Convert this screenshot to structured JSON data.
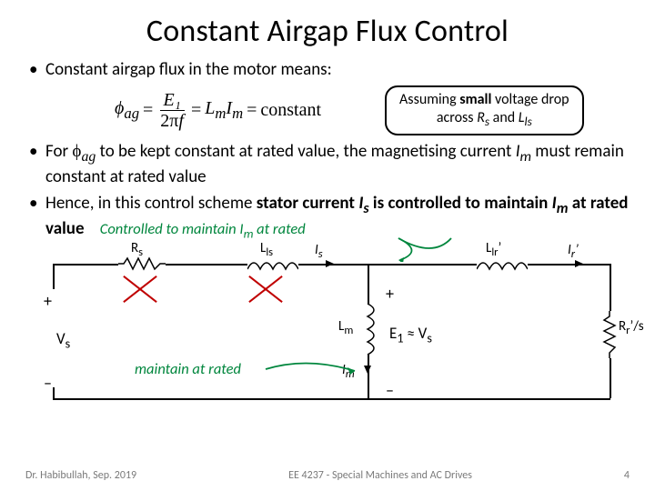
{
  "title": "Constant Airgap Flux Control",
  "bullet1": "Constant airgap flux in the motor means:",
  "equation": {
    "phi": "ϕ",
    "phi_sub": "ag",
    "eq1": "=",
    "num": "E₁",
    "den_pre": "2π",
    "den_var": "f",
    "eq2": "=",
    "lm": "L",
    "lm_sub": "m",
    "im": "I",
    "im_sub": "m",
    "eq3": "=",
    "const": "constant"
  },
  "callout_line1a": "Assuming ",
  "callout_line1b": "small",
  "callout_line1c": " voltage drop",
  "callout_line2a": "across ",
  "callout_line2b": "R",
  "callout_line2c": "s",
  "callout_line2d": " and ",
  "callout_line2e": "L",
  "callout_line2f": "ls",
  "bullet2a": "For ",
  "bullet2b": "ϕ",
  "bullet2c": "ag",
  "bullet2d": " to be kept constant at rated value, the magnetising current ",
  "bullet2e": "I",
  "bullet2f": "m",
  "bullet2g": " must remain constant at rated value",
  "bullet3a": "Hence, in this control scheme ",
  "bullet3b": "stator current ",
  "bullet3c": "I",
  "bullet3d": "s",
  "bullet3e": " is controlled to maintain ",
  "bullet3f": "I",
  "bullet3g": "m",
  "bullet3h": " at rated value",
  "green1a": "Controlled to maintain I",
  "green1b": "m",
  "green1c": " at rated",
  "labels": {
    "Rs": "R",
    "Rs_sub": "s",
    "Lls": "L",
    "Lls_sub": "ls",
    "Is": "I",
    "Is_sub": "s",
    "Llr": "L",
    "Llr_sub": "lr",
    "Llr_prime": "’",
    "Ir": "I",
    "Ir_sub": "r",
    "Ir_prime": "’",
    "plusL": "+",
    "minusL": "–",
    "plusR": "+",
    "minusR": "–",
    "Vs": "V",
    "Vs_sub": "s",
    "Lm": "L",
    "Lm_sub": "m",
    "Im": "I",
    "Im_sub": "m",
    "E1": "E",
    "E1_sub": "1",
    "approx": "≈",
    "Vs2": "V",
    "Vs2_sub": "s",
    "Rr": "R",
    "Rr_sub": "r",
    "Rr_prime": "’",
    "slash": "/s"
  },
  "green2": "maintain at rated",
  "footer_left": "Dr. Habibullah, Sep. 2019",
  "footer_mid": "EE 4237 - Special Machines and AC Drives",
  "footer_right": "4"
}
